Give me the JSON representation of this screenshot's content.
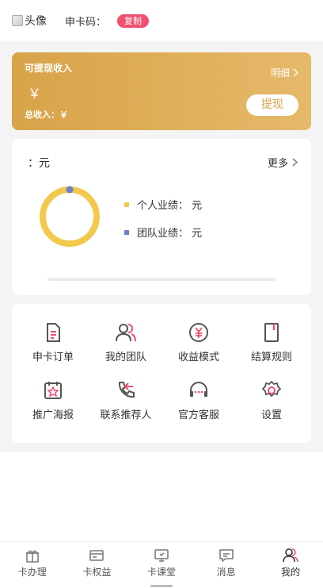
{
  "header": {
    "avatar_alt": "头像",
    "card_code_label": "申卡码：",
    "copy_label": "复制"
  },
  "income": {
    "title": "可提现收入",
    "amount": "￥",
    "total": "总收入：￥",
    "detail_label": "明细",
    "withdraw_label": "提现"
  },
  "performance": {
    "unit_line": "：元",
    "more_label": "更多",
    "personal_label": "个人业绩： 元",
    "team_label": "团队业绩： 元",
    "colors": {
      "personal": "#f2c94c",
      "team": "#6a7fc8"
    }
  },
  "grid": {
    "items": [
      {
        "label": "申卡订单",
        "icon": "document-icon"
      },
      {
        "label": "我的团队",
        "icon": "team-icon"
      },
      {
        "label": "收益模式",
        "icon": "yen-coin-icon"
      },
      {
        "label": "结算规则",
        "icon": "book-icon"
      },
      {
        "label": "推广海报",
        "icon": "poster-icon"
      },
      {
        "label": "联系推荐人",
        "icon": "phone-icon"
      },
      {
        "label": "官方客服",
        "icon": "headset-icon"
      },
      {
        "label": "设置",
        "icon": "gear-icon"
      }
    ]
  },
  "tabbar": {
    "tabs": [
      {
        "label": "卡办理",
        "icon": "gift-icon"
      },
      {
        "label": "卡权益",
        "icon": "card-icon"
      },
      {
        "label": "卡课堂",
        "icon": "screen-icon"
      },
      {
        "label": "消息",
        "icon": "message-icon"
      },
      {
        "label": "我的",
        "icon": "user-icon",
        "active": true
      }
    ]
  },
  "colors": {
    "accent": "#f0506e",
    "gold": "#d8a349"
  }
}
